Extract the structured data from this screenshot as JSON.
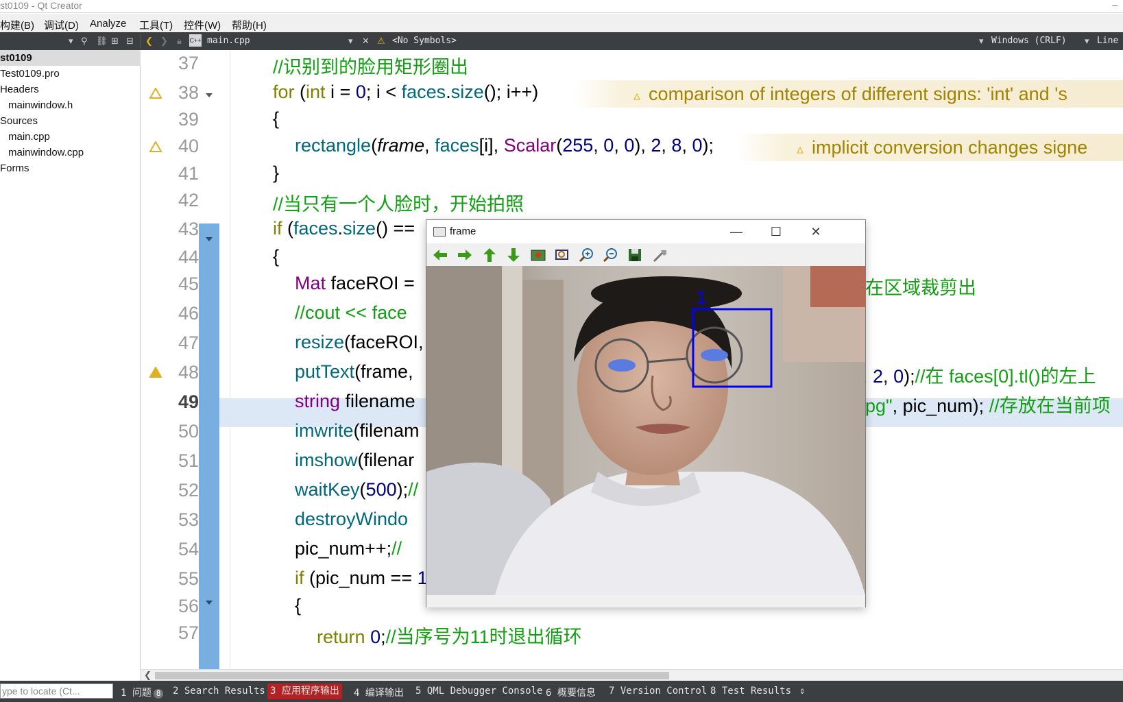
{
  "window": {
    "title": "st0109 - Qt Creator"
  },
  "menu": [
    "构建(B)",
    "调试(D)",
    "Analyze",
    "工具(T)",
    "控件(W)",
    "帮助(H)"
  ],
  "toolbar": {
    "file_name": "main.cpp",
    "symbols": "<No Symbols>",
    "line_ending": "Windows (CRLF)",
    "line_label": "Line"
  },
  "sidebar": {
    "project": "st0109",
    "items": [
      "Test0109.pro",
      "Headers",
      "mainwindow.h",
      "Sources",
      "main.cpp",
      "mainwindow.cpp",
      "Forms"
    ]
  },
  "editor": {
    "line_numbers": [
      "37",
      "38",
      "39",
      "40",
      "41",
      "42",
      "43",
      "44",
      "45",
      "46",
      "47",
      "48",
      "49",
      "50",
      "51",
      "52",
      "53",
      "54",
      "55",
      "56",
      "57"
    ],
    "current_line": "49",
    "warnings": {
      "line38": "comparison of integers of different signs: 'int' and 's",
      "line40": "implicit conversion changes signe"
    }
  },
  "frame_window": {
    "title": "frame",
    "detection_label": "1"
  },
  "statusbar": {
    "locate_placeholder": "ype to locate (Ct...",
    "panes": [
      {
        "label": "1 问题",
        "badge": "8"
      },
      {
        "label": "2 Search Results"
      },
      {
        "label": "3 应用程序输出"
      },
      {
        "label": "4 编译输出"
      },
      {
        "label": "5 QML Debugger Console"
      },
      {
        "label": "6 概要信息"
      },
      {
        "label": "7 Version Control"
      },
      {
        "label": "8 Test Results"
      }
    ]
  },
  "colors": {
    "comment": "#11a011",
    "keyword": "#808000",
    "type": "#800080",
    "function": "#00677c",
    "number": "#000080",
    "fold_region": "#78aee0",
    "active_pane": "#b22222"
  }
}
